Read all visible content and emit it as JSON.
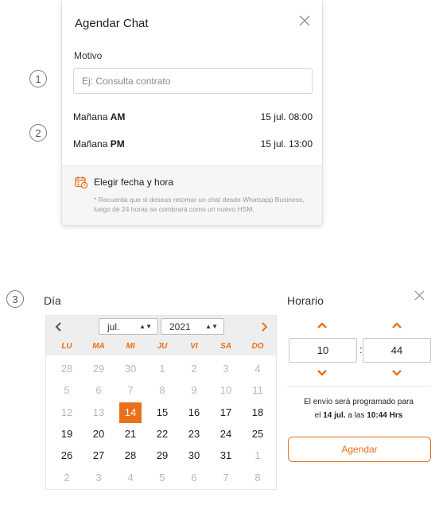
{
  "card": {
    "title": "Agendar Chat",
    "motivo_label": "Motivo",
    "motivo_placeholder": "Ej: Consulta contrato",
    "motivo_value": "",
    "options": [
      {
        "prefix": "Mañana ",
        "period": "AM",
        "datetime": "15 jul. 08:00"
      },
      {
        "prefix": "Mañana ",
        "period": "PM",
        "datetime": "15 jul. 13:00"
      }
    ],
    "pick_date_label": "Elegir fecha y hora",
    "note": "* Recuerda que si deseas retomar un chat desde Whatsapp Business, luego de 24 horas se combrará como un nuevo HSM."
  },
  "markers": [
    "1",
    "2",
    "3"
  ],
  "calendar": {
    "title": "Día",
    "month": "jul.",
    "year": "2021",
    "weekdays": [
      "LU",
      "MA",
      "MI",
      "JU",
      "VI",
      "SA",
      "DO"
    ],
    "weeks": [
      [
        {
          "d": "28",
          "dim": true
        },
        {
          "d": "29",
          "dim": true
        },
        {
          "d": "30",
          "dim": true
        },
        {
          "d": "1",
          "dim": true
        },
        {
          "d": "2",
          "dim": true
        },
        {
          "d": "3",
          "dim": true
        },
        {
          "d": "4",
          "dim": true
        }
      ],
      [
        {
          "d": "5",
          "dim": true
        },
        {
          "d": "6",
          "dim": true
        },
        {
          "d": "7",
          "dim": true
        },
        {
          "d": "8",
          "dim": true
        },
        {
          "d": "9",
          "dim": true
        },
        {
          "d": "10",
          "dim": true
        },
        {
          "d": "11",
          "dim": true
        }
      ],
      [
        {
          "d": "12",
          "dim": true
        },
        {
          "d": "13",
          "dim": true
        },
        {
          "d": "14",
          "selected": true
        },
        {
          "d": "15"
        },
        {
          "d": "16"
        },
        {
          "d": "17"
        },
        {
          "d": "18"
        }
      ],
      [
        {
          "d": "19"
        },
        {
          "d": "20"
        },
        {
          "d": "21"
        },
        {
          "d": "22"
        },
        {
          "d": "23"
        },
        {
          "d": "24"
        },
        {
          "d": "25"
        }
      ],
      [
        {
          "d": "26"
        },
        {
          "d": "27"
        },
        {
          "d": "28"
        },
        {
          "d": "29"
        },
        {
          "d": "30"
        },
        {
          "d": "31"
        },
        {
          "d": "1",
          "dim": true
        }
      ],
      [
        {
          "d": "2",
          "dim": true
        },
        {
          "d": "3",
          "dim": true
        },
        {
          "d": "4",
          "dim": true
        },
        {
          "d": "5",
          "dim": true
        },
        {
          "d": "6",
          "dim": true
        },
        {
          "d": "7",
          "dim": true
        },
        {
          "d": "8",
          "dim": true
        }
      ]
    ]
  },
  "time": {
    "title": "Horario",
    "hour": "10",
    "minute": "44",
    "colon": ":",
    "summary_line1": "El envío será programado para",
    "summary_pre": "el ",
    "summary_date": "14 jul.",
    "summary_mid": " a las ",
    "summary_time": "10:44 Hrs",
    "button_label": "Agendar"
  },
  "colors": {
    "accent": "#e8711a",
    "muted": "#b8b8b8",
    "header_bg": "#eeeeee"
  },
  "icons": [
    "close-icon",
    "calendar-clock-icon",
    "chevron-left-icon",
    "chevron-right-icon",
    "chevron-up-icon",
    "chevron-down-icon",
    "select-arrow-icon"
  ]
}
